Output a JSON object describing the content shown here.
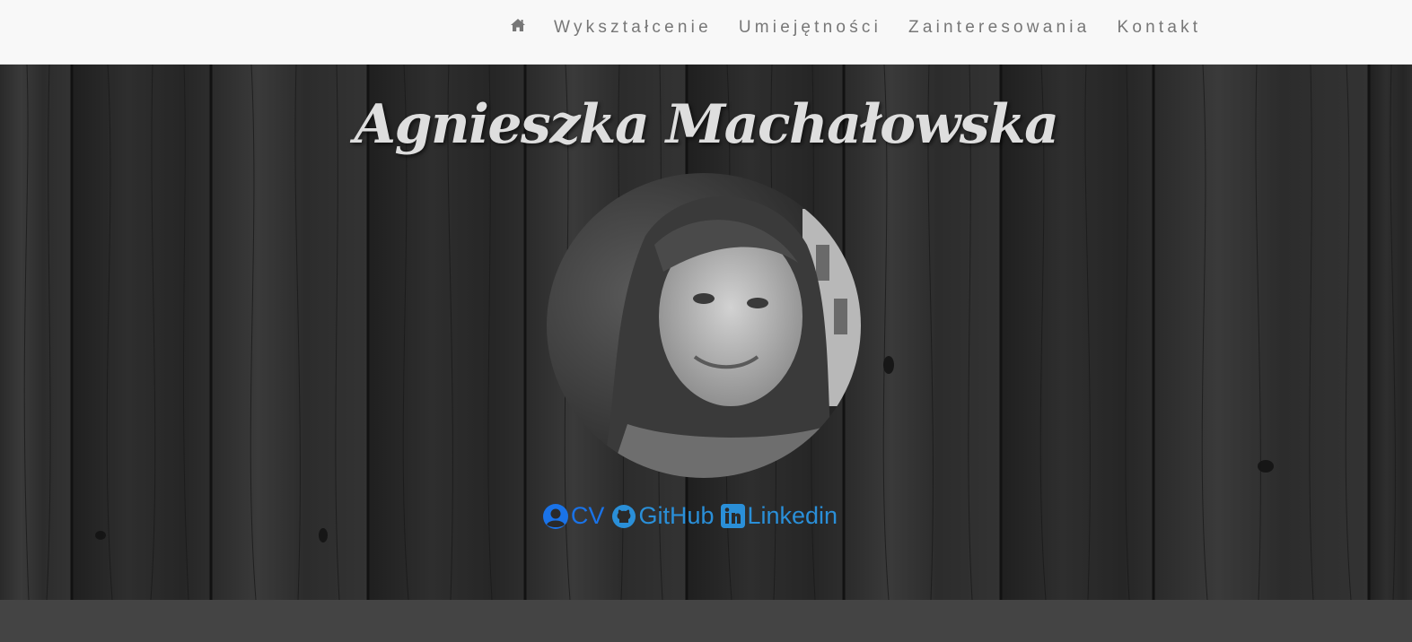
{
  "nav": {
    "home_icon": "home-icon",
    "items": [
      {
        "label": "Wykształcenie"
      },
      {
        "label": "Umiejętności"
      },
      {
        "label": "Zainteresowania"
      },
      {
        "label": "Kontakt"
      }
    ]
  },
  "hero": {
    "name": "Agnieszka Machałowska",
    "photo_icon": "profile-photo",
    "links": [
      {
        "label": "CV",
        "icon": "user-circle-icon",
        "color": "#1a73e8"
      },
      {
        "label": "GitHub",
        "icon": "github-icon",
        "color": "#2a8fd8"
      },
      {
        "label": "Linkedin",
        "icon": "linkedin-icon",
        "color": "#2a8fd8"
      }
    ]
  },
  "colors": {
    "navbar_bg": "#f8f8f8",
    "nav_text": "#777777",
    "name_text": "#dedede",
    "link_blue": "#2a8fd8",
    "footer_band": "#444444"
  }
}
